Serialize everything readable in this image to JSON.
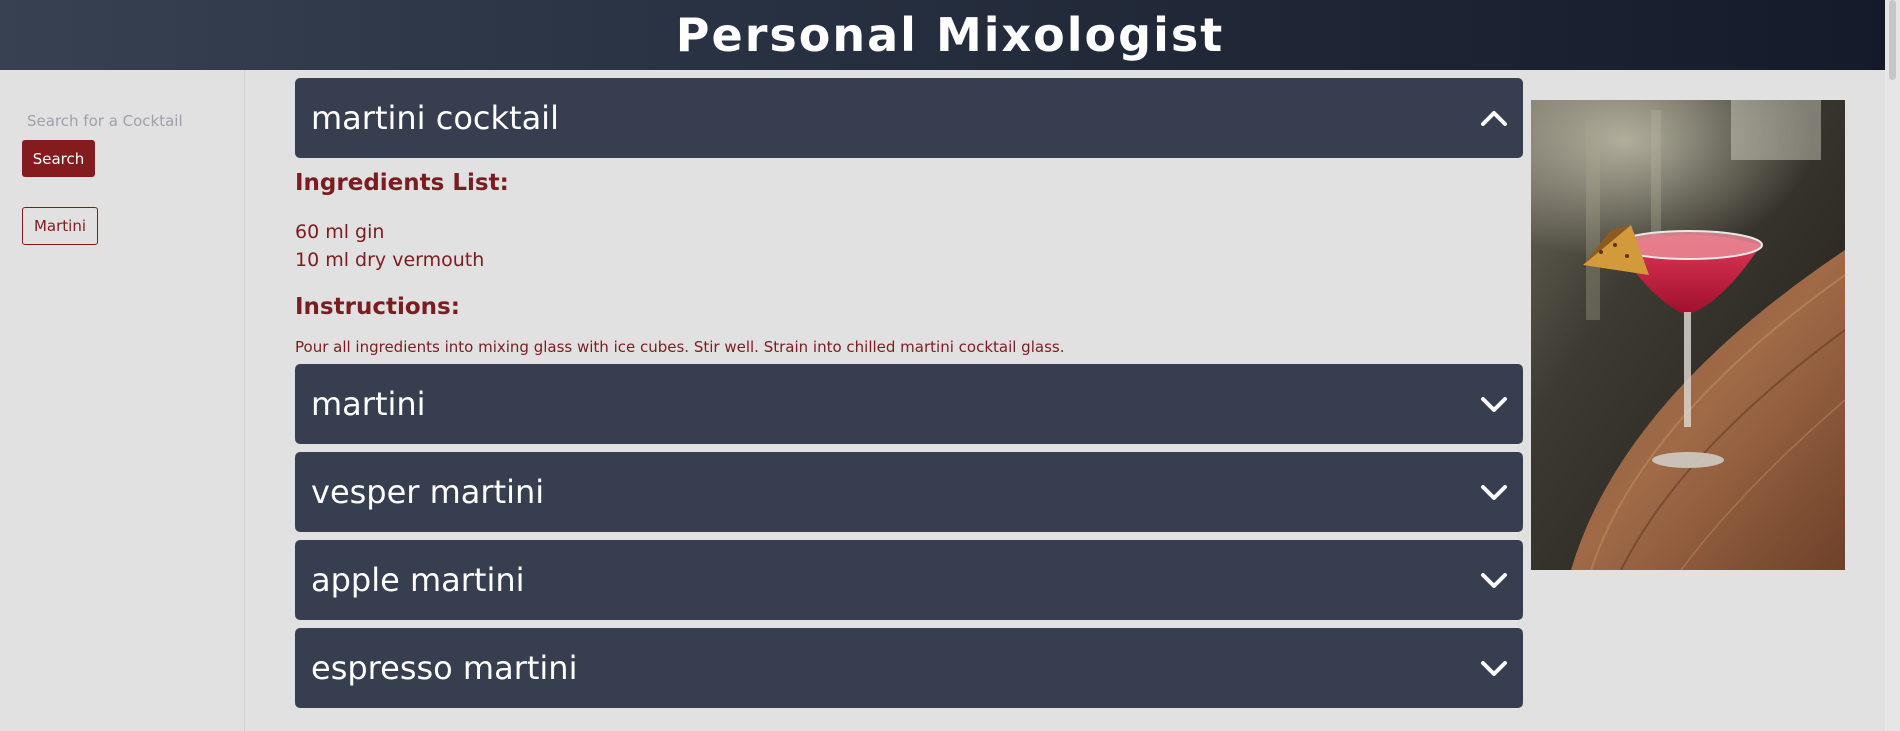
{
  "header": {
    "title": "Personal Mixologist"
  },
  "sidebar": {
    "search": {
      "placeholder": "Search for a Cocktail",
      "value": ""
    },
    "search_button": "Search",
    "history": [
      "Martini"
    ]
  },
  "results": [
    {
      "name": "martini cocktail",
      "expanded": true,
      "ingredients_heading": "Ingredients List:",
      "ingredients": [
        "60 ml gin",
        "10 ml dry vermouth"
      ],
      "instructions_heading": "Instructions:",
      "instructions": "Pour all ingredients into mixing glass with ice cubes. Stir well. Strain into chilled martini cocktail glass."
    },
    {
      "name": "martini",
      "expanded": false
    },
    {
      "name": "vesper martini",
      "expanded": false
    },
    {
      "name": "apple martini",
      "expanded": false
    },
    {
      "name": "espresso martini",
      "expanded": false
    }
  ],
  "colors": {
    "accent": "#841b1f",
    "accordion": "#363e50",
    "background": "#e1e1e1"
  },
  "icons": {
    "expanded": "chevron-up-icon",
    "collapsed": "chevron-down-icon"
  }
}
